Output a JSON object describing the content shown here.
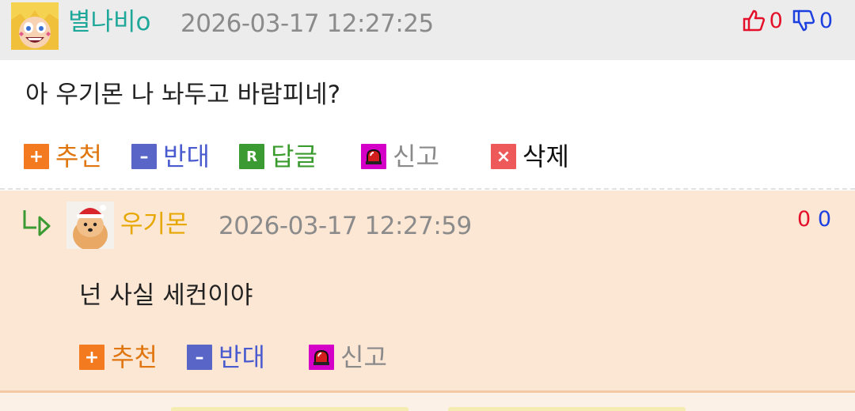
{
  "comment": {
    "author": "별나비o",
    "timestamp": "2026-03-17 12:27:25",
    "upvotes": "0",
    "downvotes": "0",
    "text": "아 우기몬 나 놔두고 바람피네?",
    "actions": {
      "recommend": "추천",
      "oppose": "반대",
      "reply": "답글",
      "report": "신고",
      "delete": "삭제"
    },
    "icons": {
      "recommend": "+",
      "oppose": "–",
      "reply": "R",
      "delete": "×"
    }
  },
  "reply": {
    "author": "우기몬",
    "timestamp": "2026-03-17 12:27:59",
    "upvotes": "0",
    "downvotes": "0",
    "text": "넌 사실 세컨이야",
    "actions": {
      "recommend": "추천",
      "oppose": "반대",
      "report": "신고"
    }
  },
  "colors": {
    "header_bg": "#ececec",
    "reply_bg": "#fce6d4",
    "author1": "#1ea89a",
    "author2": "#e6a800",
    "up": "#e4102a",
    "down": "#1c3fe0"
  }
}
